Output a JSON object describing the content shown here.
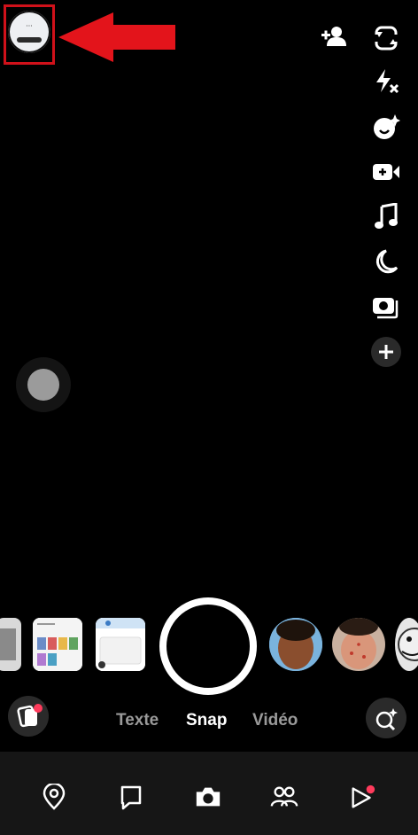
{
  "modes": {
    "text": "Texte",
    "snap": "Snap",
    "video": "Vidéo"
  },
  "colors": {
    "annotation": "#d0111a",
    "badge": "#ff3b5c",
    "background": "#000000",
    "nav_background": "#161616"
  },
  "right_rail_icons": [
    "flip-camera-icon",
    "flash-off-icon",
    "bitmoji-lens-icon",
    "dual-camera-icon",
    "music-icon",
    "night-mode-icon",
    "multi-snap-icon",
    "more-plus-icon"
  ],
  "bottom_nav_icons": [
    "map-icon",
    "chat-icon",
    "camera-icon",
    "friends-icon",
    "stories-icon"
  ]
}
